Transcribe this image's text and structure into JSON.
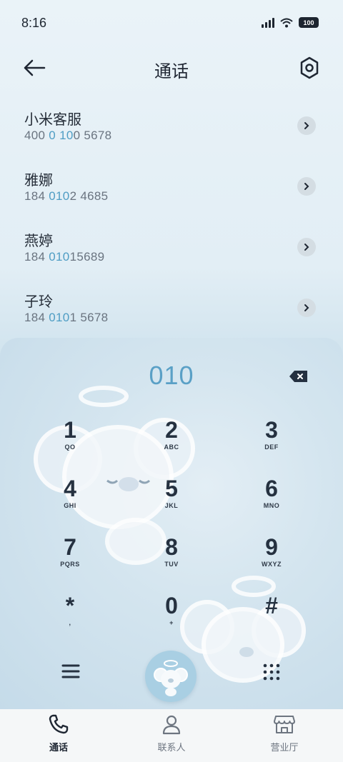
{
  "status_bar": {
    "time": "8:16",
    "battery": "100",
    "signal_icon": "signal-icon",
    "wifi_icon": "wifi-icon"
  },
  "header": {
    "title": "通话",
    "back_icon": "back-arrow-icon",
    "settings_icon": "settings-hexagon-icon"
  },
  "calls": [
    {
      "name": "小米客服",
      "number_parts": [
        "400 ",
        "0",
        " ",
        "10",
        "0 5678"
      ]
    },
    {
      "name": "雅娜",
      "number_parts": [
        "184 ",
        "010",
        "2 4685"
      ]
    },
    {
      "name": "燕婷",
      "number_parts": [
        "184 ",
        "010",
        "15689"
      ]
    },
    {
      "name": "子玲",
      "number_parts": [
        "184 ",
        "010",
        "1 5678"
      ]
    }
  ],
  "dialer": {
    "input": "010",
    "keys": [
      {
        "digit": "1",
        "letters": "QO"
      },
      {
        "digit": "2",
        "letters": "ABC"
      },
      {
        "digit": "3",
        "letters": "DEF"
      },
      {
        "digit": "4",
        "letters": "GHI"
      },
      {
        "digit": "5",
        "letters": "JKL"
      },
      {
        "digit": "6",
        "letters": "MNO"
      },
      {
        "digit": "7",
        "letters": "PQRS"
      },
      {
        "digit": "8",
        "letters": "TUV"
      },
      {
        "digit": "9",
        "letters": "WXYZ"
      },
      {
        "digit": "*",
        "letters": ","
      },
      {
        "digit": "0",
        "letters": "+"
      },
      {
        "digit": "#",
        "letters": ""
      }
    ]
  },
  "nav": {
    "tabs": [
      {
        "label": "通话",
        "active": true
      },
      {
        "label": "联系人",
        "active": false
      },
      {
        "label": "营业厅",
        "active": false
      }
    ]
  },
  "colors": {
    "accent": "#5aa0c6",
    "highlight_number": "#4f9dc4",
    "text_dark": "#252d38"
  }
}
